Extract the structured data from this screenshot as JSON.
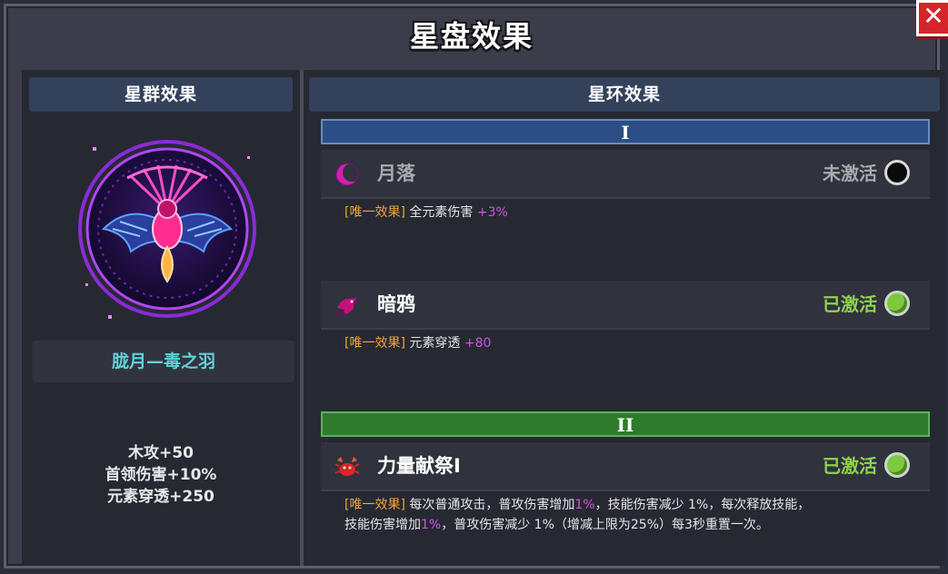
{
  "title": "星盘效果",
  "close_icon": "close-x-icon",
  "left": {
    "header": "星群效果",
    "constellation_name": "胧月—毒之羽",
    "bonuses": [
      "木攻+50",
      "首领伤害+10%",
      "元素穿透+250"
    ]
  },
  "right": {
    "header": "星环效果",
    "rings": [
      {
        "numeral": "I",
        "color": "#2d4e84",
        "effects": [
          {
            "icon": "crescent-moon-icon",
            "name": "月落",
            "status": "未激活",
            "active": false,
            "desc_tag": "[唯一效果]",
            "desc_text": "全元素伤害",
            "desc_value": "+3%"
          },
          {
            "icon": "crow-icon",
            "name": "暗鸦",
            "status": "已激活",
            "active": true,
            "desc_tag": "[唯一效果]",
            "desc_text": "元素穿透",
            "desc_value": "+80"
          }
        ]
      },
      {
        "numeral": "II",
        "color": "#2f7b2e",
        "effects": [
          {
            "icon": "crab-icon",
            "name": "力量献祭Ⅰ",
            "status": "已激活",
            "active": true,
            "desc_tag": "[唯一效果]",
            "desc_line1_a": "每次普通攻击，普攻伤害增加",
            "desc_line1_v": "1%",
            "desc_line1_b": "，技能伤害减少 1%，每次释放技能，",
            "desc_line2_a": "技能伤害增加",
            "desc_line2_v": "1%",
            "desc_line2_b": "，普攻伤害减少 1%（增减上限为25%）每3秒重置一次。"
          }
        ]
      }
    ]
  },
  "colors": {
    "active_status": "#8fd14f",
    "inactive_status": "#a9a9ad",
    "tag": "#f0a33c",
    "value": "#d050e8",
    "constellation_name": "#5fd3d9"
  }
}
